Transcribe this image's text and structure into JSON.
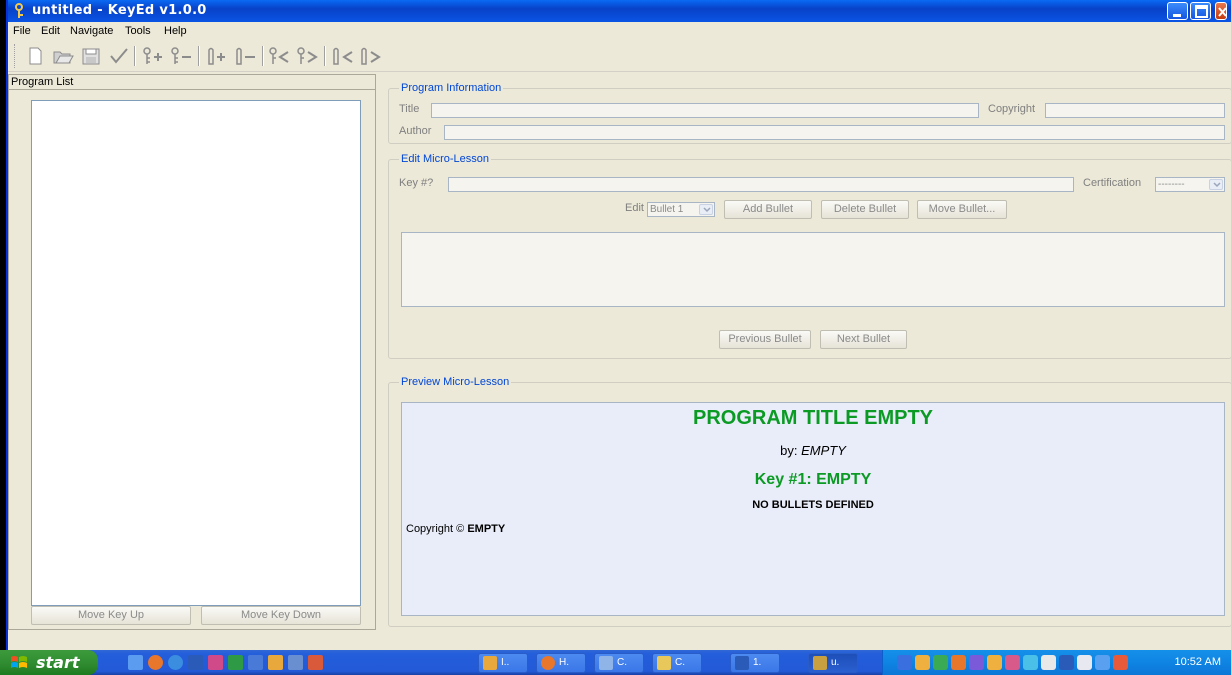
{
  "window": {
    "title": "untitled - KeyEd v1.0.0"
  },
  "menu": {
    "items": [
      "File",
      "Edit",
      "Navigate",
      "Tools",
      "Help"
    ]
  },
  "toolbar": {
    "icons": [
      "new-file-icon",
      "open-folder-icon",
      "save-icon",
      "check-icon",
      "add-key-icon",
      "remove-key-icon",
      "add-bullet-icon",
      "remove-bullet-icon",
      "previous-key-icon",
      "next-key-icon",
      "previous-bullet-icon",
      "next-bullet-icon"
    ]
  },
  "left": {
    "header": "Program List",
    "move_up": "Move Key Up",
    "move_down": "Move Key Down"
  },
  "program_info": {
    "legend": "Program Information",
    "title_label": "Title",
    "copyright_label": "Copyright",
    "author_label": "Author"
  },
  "edit": {
    "legend": "Edit Micro-Lesson",
    "key_label": "Key #?",
    "certification_label": "Certification",
    "certification_value": "--------",
    "edit_label": "Edit",
    "bullet_select": "Bullet 1",
    "add_bullet": "Add Bullet",
    "delete_bullet": "Delete Bullet",
    "move_bullet": "Move Bullet...",
    "previous_bullet": "Previous Bullet",
    "next_bullet": "Next Bullet"
  },
  "preview": {
    "legend": "Preview Micro-Lesson",
    "program_title": "PROGRAM TITLE EMPTY",
    "by_label": "by:",
    "author": "EMPTY",
    "key_heading": "Key #1: EMPTY",
    "bullets": "NO BULLETS DEFINED",
    "copyright_label": "Copyright ©",
    "copyright_value": "EMPTY"
  },
  "colors": {
    "preview_green": "#0B9B24",
    "legend_blue": "#0046D5"
  },
  "taskbar": {
    "start": "start",
    "tasks": [
      "I..",
      "H.",
      "C.",
      "C.",
      "1.",
      "u."
    ],
    "clock": "10:52 AM"
  }
}
